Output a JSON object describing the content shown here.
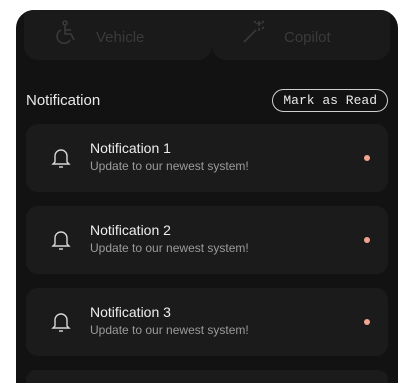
{
  "tiles": [
    {
      "label": "Vehicle",
      "icon": "accessibility-icon"
    },
    {
      "label": "Copilot",
      "icon": "magic-wand-icon"
    }
  ],
  "section": {
    "title": "Notification",
    "action_label": "Mark as Read"
  },
  "notifications": [
    {
      "title": "Notification 1",
      "subtitle": "Update to our newest system!"
    },
    {
      "title": "Notification 2",
      "subtitle": "Update to our newest system!"
    },
    {
      "title": "Notification 3",
      "subtitle": "Update to our newest system!"
    }
  ],
  "colors": {
    "background": "#121212",
    "card": "#1b1b1b",
    "unread_dot": "#f2a48e"
  }
}
